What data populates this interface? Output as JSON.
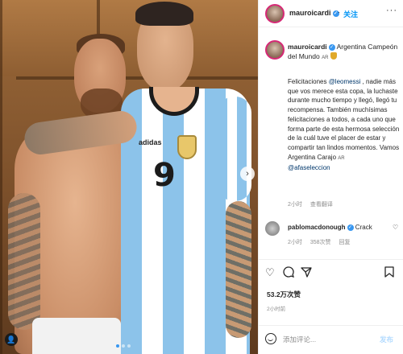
{
  "header": {
    "username": "mauroicardi",
    "follow_separator": "·",
    "follow_label": "关注",
    "more_label": "···"
  },
  "caption": {
    "username": "mauroicardi",
    "headline": "Argentina Campeón del Mundo",
    "flag_text": "AR",
    "body_1": "Felicitaciones ",
    "mention_1": "@leomessi",
    "body_2": " , nadie más que vos merece esta copa, la luchaste durante mucho tiempo y llegó, llegó tu recompensa. También muchísimas felicitaciones a todos, a cada uno que forma parte de esta hermosa selección de la cuál tuve el placer de estar y compartir tan lindos momentos. Vamos Argentina Carajo ",
    "flag_text_2": "AR",
    "mention_2": "@afaseleccion",
    "time": "2小时",
    "translate_label": "查看翻译"
  },
  "comment": {
    "username": "pablomacdonough",
    "text": "Crack",
    "time": "2小时",
    "likes": "358次赞",
    "reply_label": "回复"
  },
  "post": {
    "likes": "53.2万次赞",
    "time": "2小时前"
  },
  "composer": {
    "placeholder": "添加评论...",
    "post_label": "发布"
  },
  "photo": {
    "jersey_number": "9",
    "brand_text": "adidas",
    "next_label": "›",
    "user_tag_label": "👤"
  },
  "icons": {
    "like": "heart-icon",
    "comment": "comment-icon",
    "share": "send-icon",
    "save": "bookmark-icon",
    "emoji": "emoji-icon",
    "comment_like": "heart-icon",
    "verified": "verified-icon"
  },
  "colors": {
    "accent_blue": "#0095f6",
    "mention_blue": "#00376b",
    "jersey_blue": "#8cc3ea",
    "muted": "#8e8e8e"
  }
}
